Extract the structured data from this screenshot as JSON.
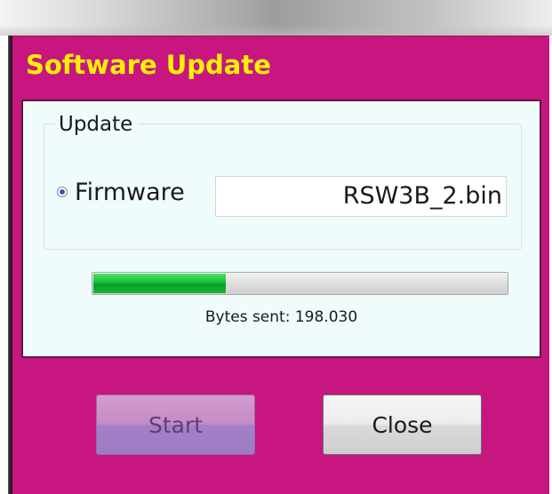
{
  "window": {
    "title": "Software Update"
  },
  "update_group": {
    "label": "Update",
    "firmware_option": {
      "label": "Firmware",
      "selected": true,
      "file_value": "RSW3B_2.bin"
    }
  },
  "progress": {
    "fraction": 0.32,
    "bytes_sent_line": "Bytes sent: 198.030"
  },
  "buttons": {
    "start_label": "Start",
    "start_enabled": false,
    "close_label": "Close"
  },
  "colors": {
    "window_background": "#c71680",
    "title_text": "#fff200",
    "panel_background": "#f0fbfc",
    "progress_fill": "#17c038"
  },
  "icons": {
    "firmware_radio": "radio-selected-icon"
  }
}
